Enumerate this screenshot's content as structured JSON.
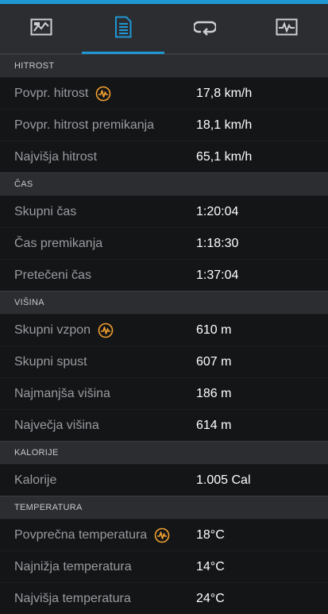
{
  "colors": {
    "accent": "#1f97d3",
    "trend_icon": "#f0a030",
    "background": "#141517",
    "header": "#2c2d31"
  },
  "tabs": [
    {
      "icon": "map-icon",
      "active": false
    },
    {
      "icon": "document-list-icon",
      "active": true
    },
    {
      "icon": "loop-icon",
      "active": false
    },
    {
      "icon": "graph-icon",
      "active": false
    }
  ],
  "sections": [
    {
      "title": "HITROST",
      "rows": [
        {
          "label": "Povpr. hitrost",
          "value": "17,8 km/h",
          "trend_icon": true
        },
        {
          "label": "Povpr. hitrost premikanja",
          "value": "18,1 km/h",
          "trend_icon": false
        },
        {
          "label": "Najvišja hitrost",
          "value": "65,1 km/h",
          "trend_icon": false
        }
      ]
    },
    {
      "title": "ČAS",
      "rows": [
        {
          "label": "Skupni čas",
          "value": "1:20:04",
          "trend_icon": false
        },
        {
          "label": "Čas premikanja",
          "value": "1:18:30",
          "trend_icon": false
        },
        {
          "label": "Pretečeni čas",
          "value": "1:37:04",
          "trend_icon": false
        }
      ]
    },
    {
      "title": "VIŠINA",
      "rows": [
        {
          "label": "Skupni vzpon",
          "value": "610 m",
          "trend_icon": true
        },
        {
          "label": "Skupni spust",
          "value": "607 m",
          "trend_icon": false
        },
        {
          "label": "Najmanjša višina",
          "value": "186 m",
          "trend_icon": false
        },
        {
          "label": "Največja višina",
          "value": "614 m",
          "trend_icon": false
        }
      ]
    },
    {
      "title": "KALORIJE",
      "rows": [
        {
          "label": "Kalorije",
          "value": "1.005 Cal",
          "trend_icon": false
        }
      ]
    },
    {
      "title": "TEMPERATURA",
      "rows": [
        {
          "label": "Povprečna temperatura",
          "value": "18°C",
          "trend_icon": true
        },
        {
          "label": "Najnižja temperatura",
          "value": "14°C",
          "trend_icon": false
        },
        {
          "label": "Najvišja temperatura",
          "value": "24°C",
          "trend_icon": false
        }
      ]
    }
  ]
}
